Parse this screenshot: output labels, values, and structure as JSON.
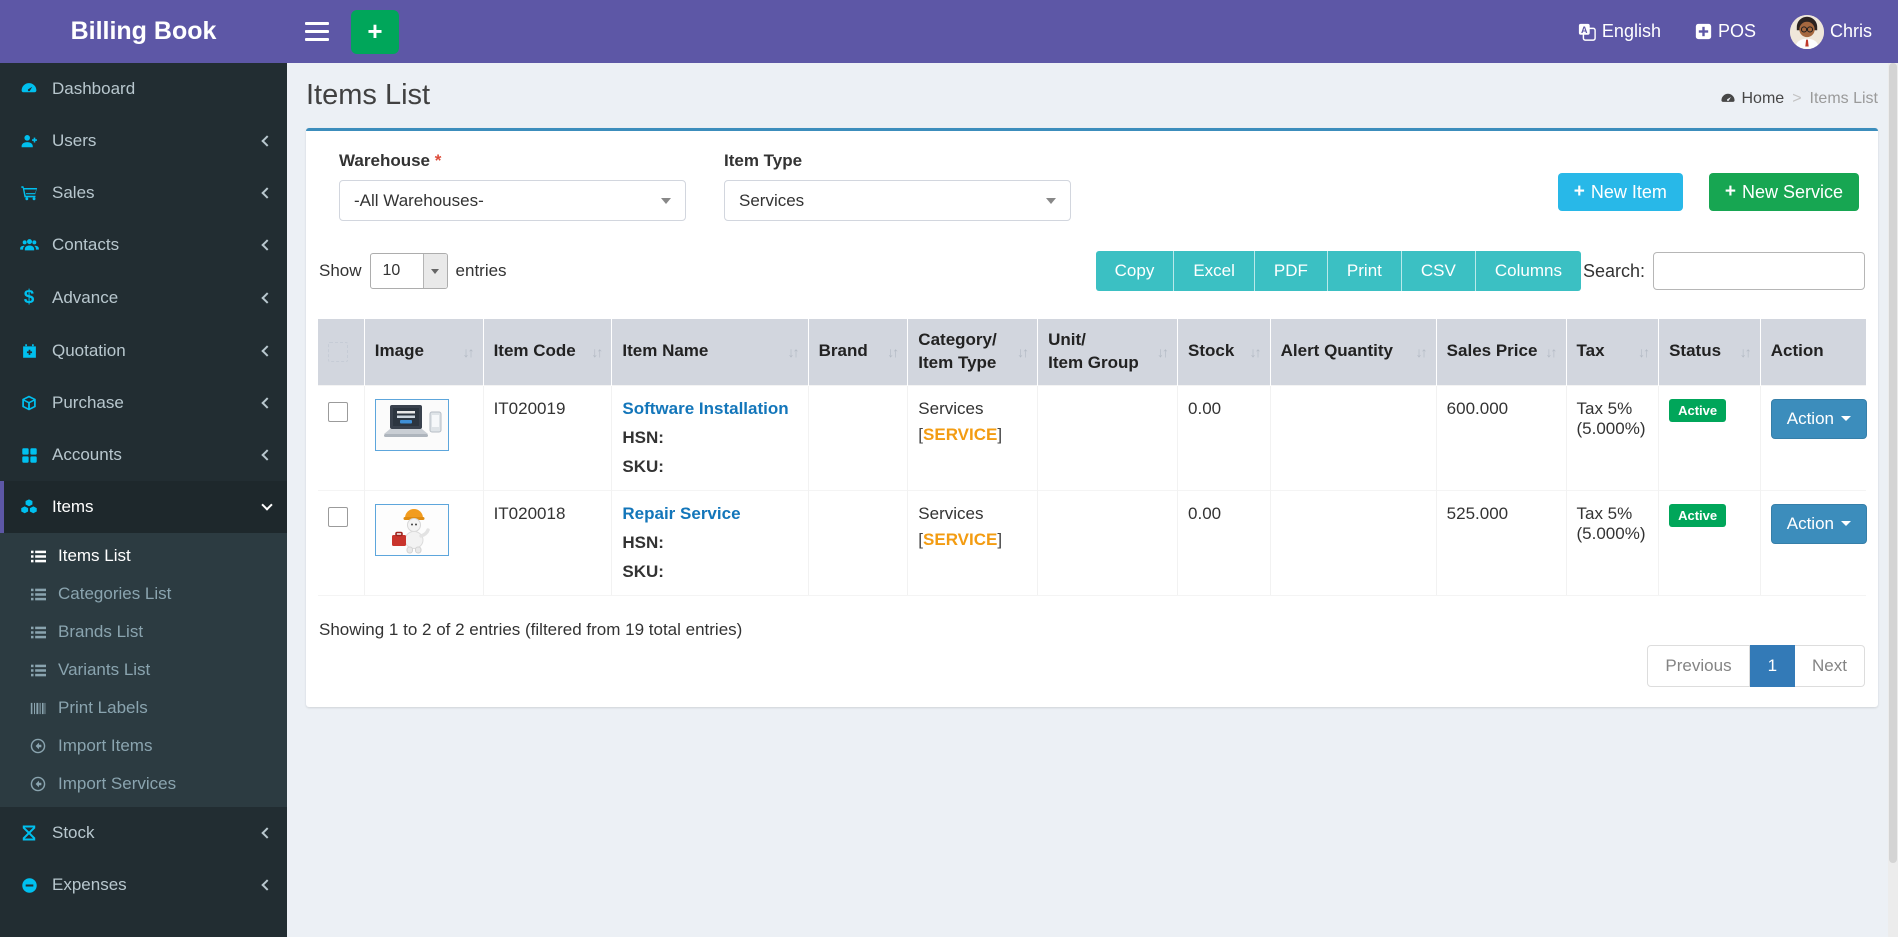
{
  "app": {
    "title": "Billing Book"
  },
  "topbar": {
    "quick_add_label": "+",
    "language_label": "English",
    "pos_label": "POS",
    "user_name": "Chris"
  },
  "sidebar": {
    "items": [
      {
        "label": "Dashboard"
      },
      {
        "label": "Users"
      },
      {
        "label": "Sales"
      },
      {
        "label": "Contacts"
      },
      {
        "label": "Advance"
      },
      {
        "label": "Quotation"
      },
      {
        "label": "Purchase"
      },
      {
        "label": "Accounts"
      },
      {
        "label": "Items"
      },
      {
        "label": "Stock"
      },
      {
        "label": "Expenses"
      }
    ],
    "items_submenu": [
      {
        "label": "Items List"
      },
      {
        "label": "Categories List"
      },
      {
        "label": "Brands List"
      },
      {
        "label": "Variants List"
      },
      {
        "label": "Print Labels"
      },
      {
        "label": "Import Items"
      },
      {
        "label": "Import Services"
      }
    ]
  },
  "page": {
    "title": "Items List",
    "breadcrumb_home": "Home",
    "breadcrumb_separator": ">",
    "breadcrumb_current": "Items List"
  },
  "filters": {
    "warehouse_label": "Warehouse",
    "required_mark": "*",
    "warehouse_value": "-All Warehouses-",
    "item_type_label": "Item Type",
    "item_type_value": "Services",
    "plus_sign": "+",
    "new_item_label": "New Item",
    "new_service_label": "New Service"
  },
  "toolbar": {
    "show_label": "Show",
    "page_length_value": "10",
    "entries_label": "entries",
    "export_buttons": [
      "Copy",
      "Excel",
      "PDF",
      "Print",
      "CSV",
      "Columns"
    ],
    "search_label": "Search:",
    "search_value": ""
  },
  "table": {
    "columns": [
      {
        "label": ""
      },
      {
        "label": "Image"
      },
      {
        "label": "Item Code"
      },
      {
        "label": "Item Name"
      },
      {
        "label": "Brand"
      },
      {
        "label": "Category/",
        "label2": "Item Type"
      },
      {
        "label": "Unit/",
        "label2": "Item Group"
      },
      {
        "label": "Stock"
      },
      {
        "label": "Alert Quantity"
      },
      {
        "label": "Sales Price"
      },
      {
        "label": "Tax"
      },
      {
        "label": "Status"
      },
      {
        "label": "Action"
      }
    ],
    "rows": [
      {
        "image_name": "laptop-software-product-image",
        "item_code": "IT020019",
        "item_name": "Software Installation",
        "hsn_label": "HSN:",
        "sku_label": "SKU:",
        "brand": "",
        "category": "Services",
        "category_tag_open": "[",
        "category_tag": "SERVICE",
        "category_tag_close": "]",
        "unit_group": "",
        "stock": "0.00",
        "alert_quantity": "",
        "sales_price": "600.000",
        "tax_rate": "Tax 5%",
        "tax_percent": "(5.000%)",
        "status": "Active",
        "action_label": "Action"
      },
      {
        "image_name": "repair-service-mascot-image",
        "item_code": "IT020018",
        "item_name": "Repair Service",
        "hsn_label": "HSN:",
        "sku_label": "SKU:",
        "brand": "",
        "category": "Services",
        "category_tag_open": "[",
        "category_tag": "SERVICE",
        "category_tag_close": "]",
        "unit_group": "",
        "stock": "0.00",
        "alert_quantity": "",
        "sales_price": "525.000",
        "tax_rate": "Tax 5%",
        "tax_percent": "(5.000%)",
        "status": "Active",
        "action_label": "Action"
      }
    ]
  },
  "summary": {
    "info": "Showing 1 to 2 of 2 entries (filtered from 19 total entries)"
  },
  "pagination": {
    "previous": "Previous",
    "page": "1",
    "next": "Next"
  },
  "colors": {
    "navbar_purple": "#5d57a6",
    "sidebar_dark": "#222d32",
    "icon_cyan": "#00c0ef",
    "card_top_border": "#3c8dbc",
    "new_item_cyan": "#28b8e8",
    "new_service_green": "#17a652",
    "export_teal": "#3bc0c3",
    "status_green": "#00a65a",
    "action_blue": "#3c8dbc",
    "tag_orange": "#f39c12",
    "active_page_blue": "#337ab7"
  }
}
